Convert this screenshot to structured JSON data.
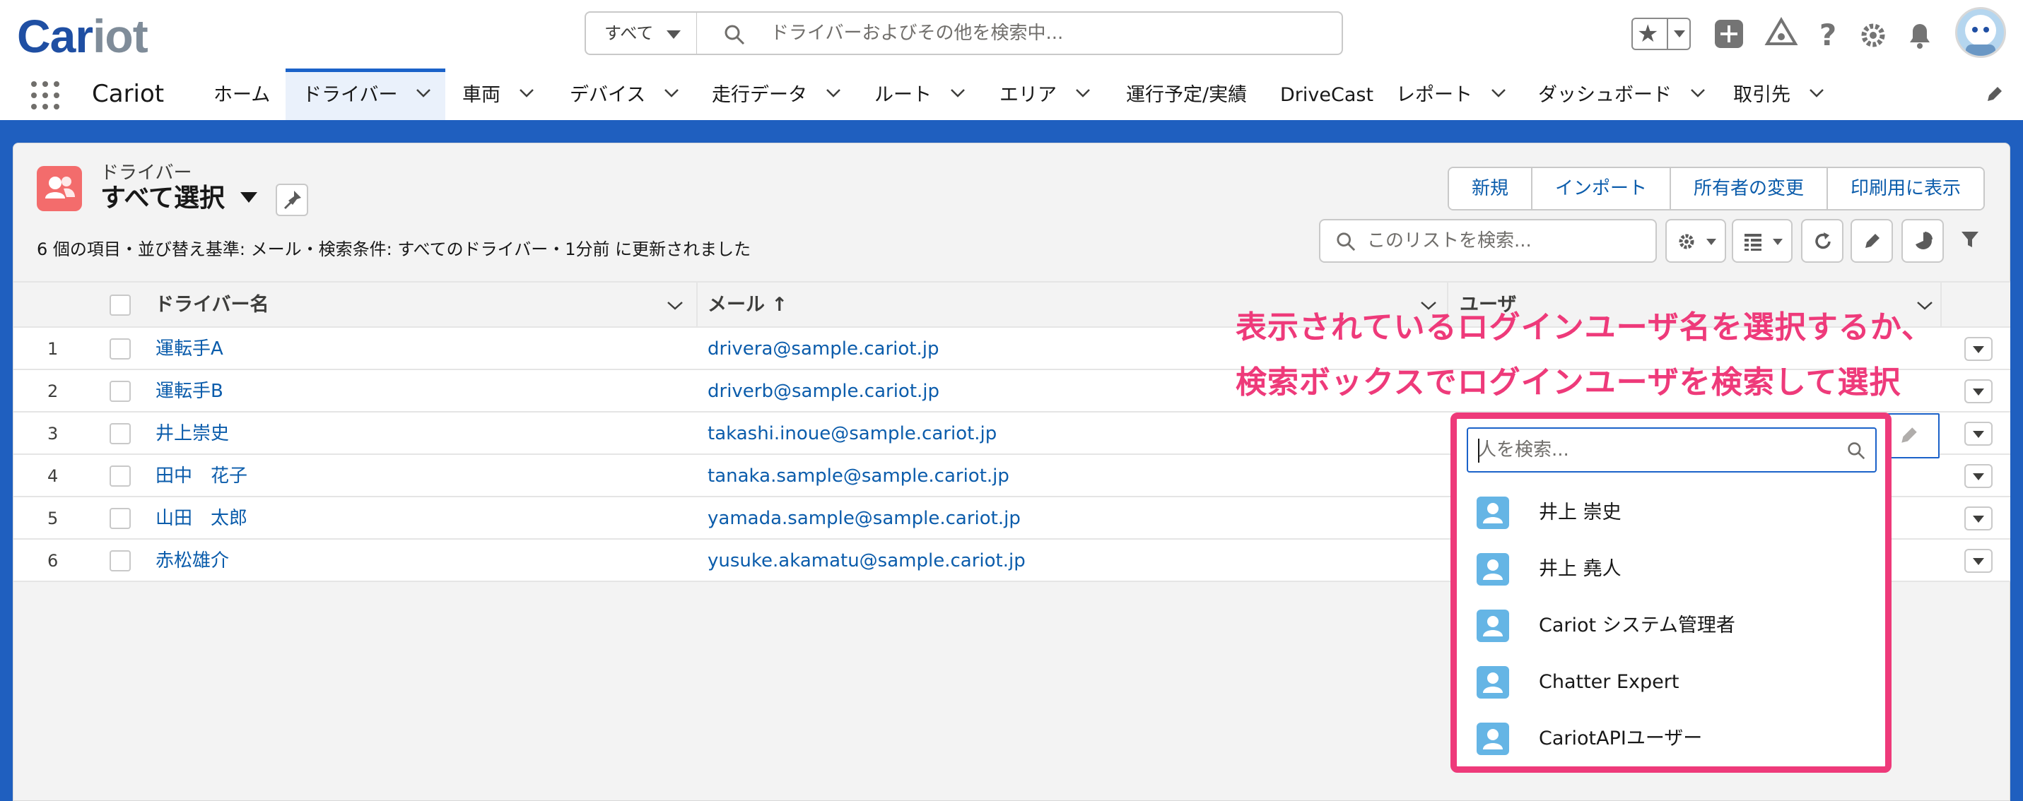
{
  "header": {
    "logo_part1": "Car",
    "logo_part2": "iot",
    "search_scope": "すべて",
    "search_placeholder": "ドライバーおよびその他を検索中..."
  },
  "nav": {
    "app_name": "Cariot",
    "tabs": [
      {
        "label": "ホーム"
      },
      {
        "label": "ドライバー"
      },
      {
        "label": "車両"
      },
      {
        "label": "デバイス"
      },
      {
        "label": "走行データ"
      },
      {
        "label": "ルート"
      },
      {
        "label": "エリア"
      },
      {
        "label": "運行予定/実績"
      },
      {
        "label": "DriveCast"
      },
      {
        "label": "レポート"
      },
      {
        "label": "ダッシュボード"
      },
      {
        "label": "取引先"
      }
    ]
  },
  "list": {
    "object_label": "ドライバー",
    "view_name": "すべて選択",
    "meta": "6 個の項目・並び替え基準: メール・検索条件: すべてのドライバー・1分前 に更新されました",
    "actions": [
      "新規",
      "インポート",
      "所有者の変更",
      "印刷用に表示"
    ],
    "search_placeholder": "このリストを検索..."
  },
  "table": {
    "columns": {
      "name": "ドライバー名",
      "email": "メール ↑",
      "user": "ユーザ"
    },
    "rows": [
      {
        "num": "1",
        "name": "運転手A",
        "email": "drivera@sample.cariot.jp"
      },
      {
        "num": "2",
        "name": "運転手B",
        "email": "driverb@sample.cariot.jp"
      },
      {
        "num": "3",
        "name": "井上崇史",
        "email": "takashi.inoue@sample.cariot.jp"
      },
      {
        "num": "4",
        "name": "田中　花子",
        "email": "tanaka.sample@sample.cariot.jp"
      },
      {
        "num": "5",
        "name": "山田　太郎",
        "email": "yamada.sample@sample.cariot.jp"
      },
      {
        "num": "6",
        "name": "赤松雄介",
        "email": "yusuke.akamatu@sample.cariot.jp"
      }
    ]
  },
  "annotation": {
    "line1": "表示されているログインユーザ名を選択するか、",
    "line2": "検索ボックスでログインユーザを検索して選択"
  },
  "lookup": {
    "placeholder": "人を検索...",
    "options": [
      {
        "name": "井上 崇史"
      },
      {
        "name": "井上 堯人"
      },
      {
        "name": "Cariot システム管理者"
      },
      {
        "name": "Chatter Expert"
      },
      {
        "name": "CariotAPIユーザー"
      }
    ]
  },
  "colors": {
    "brand_blue": "#1f5fbf",
    "link": "#0b5cab",
    "annotation_pink": "#ee3a7a",
    "object_icon": "#f36c6c",
    "user_icon": "#65b5e5"
  }
}
